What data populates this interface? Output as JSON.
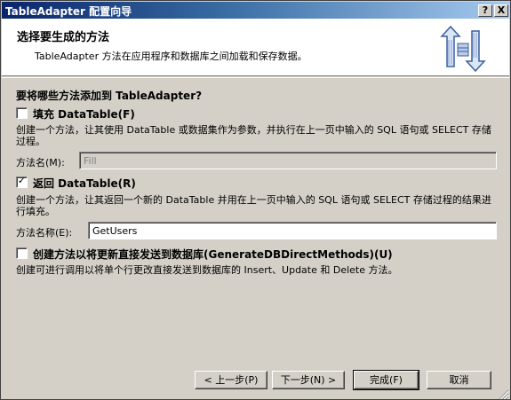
{
  "window": {
    "title": "TableAdapter 配置向导",
    "help_label": "?",
    "close_label": "X"
  },
  "header": {
    "title": "选择要生成的方法",
    "description": "TableAdapter 方法在应用程序和数据库之间加载和保存数据。",
    "icon": "table-adapter-arrows-icon"
  },
  "question": "要将哪些方法添加到 TableAdapter?",
  "fill_option": {
    "checked": false,
    "label": "填充 DataTable(F)",
    "description": "创建一个方法，让其使用 DataTable 或数据集作为参数，并执行在上一页中输入的 SQL 语句或 SELECT 存储过程。",
    "name_label": "方法名(M):",
    "name_value": "Fill"
  },
  "return_option": {
    "checked": true,
    "label": "返回 DataTable(R)",
    "description": "创建一个方法，让其返回一个新的 DataTable 并用在上一页中输入的 SQL 语句或 SELECT 存储过程的结果进行填充。",
    "name_label": "方法名称(E):",
    "name_value": "GetUsers"
  },
  "direct_option": {
    "checked": false,
    "label": "创建方法以将更新直接发送到数据库(GenerateDBDirectMethods)(U)",
    "description": "创建可进行调用以将单个行更改直接发送到数据库的 Insert、Update 和 Delete 方法。"
  },
  "buttons": {
    "back": "< 上一步(P)",
    "next": "下一步(N) >",
    "finish": "完成(F)",
    "cancel": "取消"
  },
  "colors": {
    "titlebar_start": "#0a246a",
    "titlebar_end": "#a6caf0",
    "face": "#d4d0c8"
  }
}
